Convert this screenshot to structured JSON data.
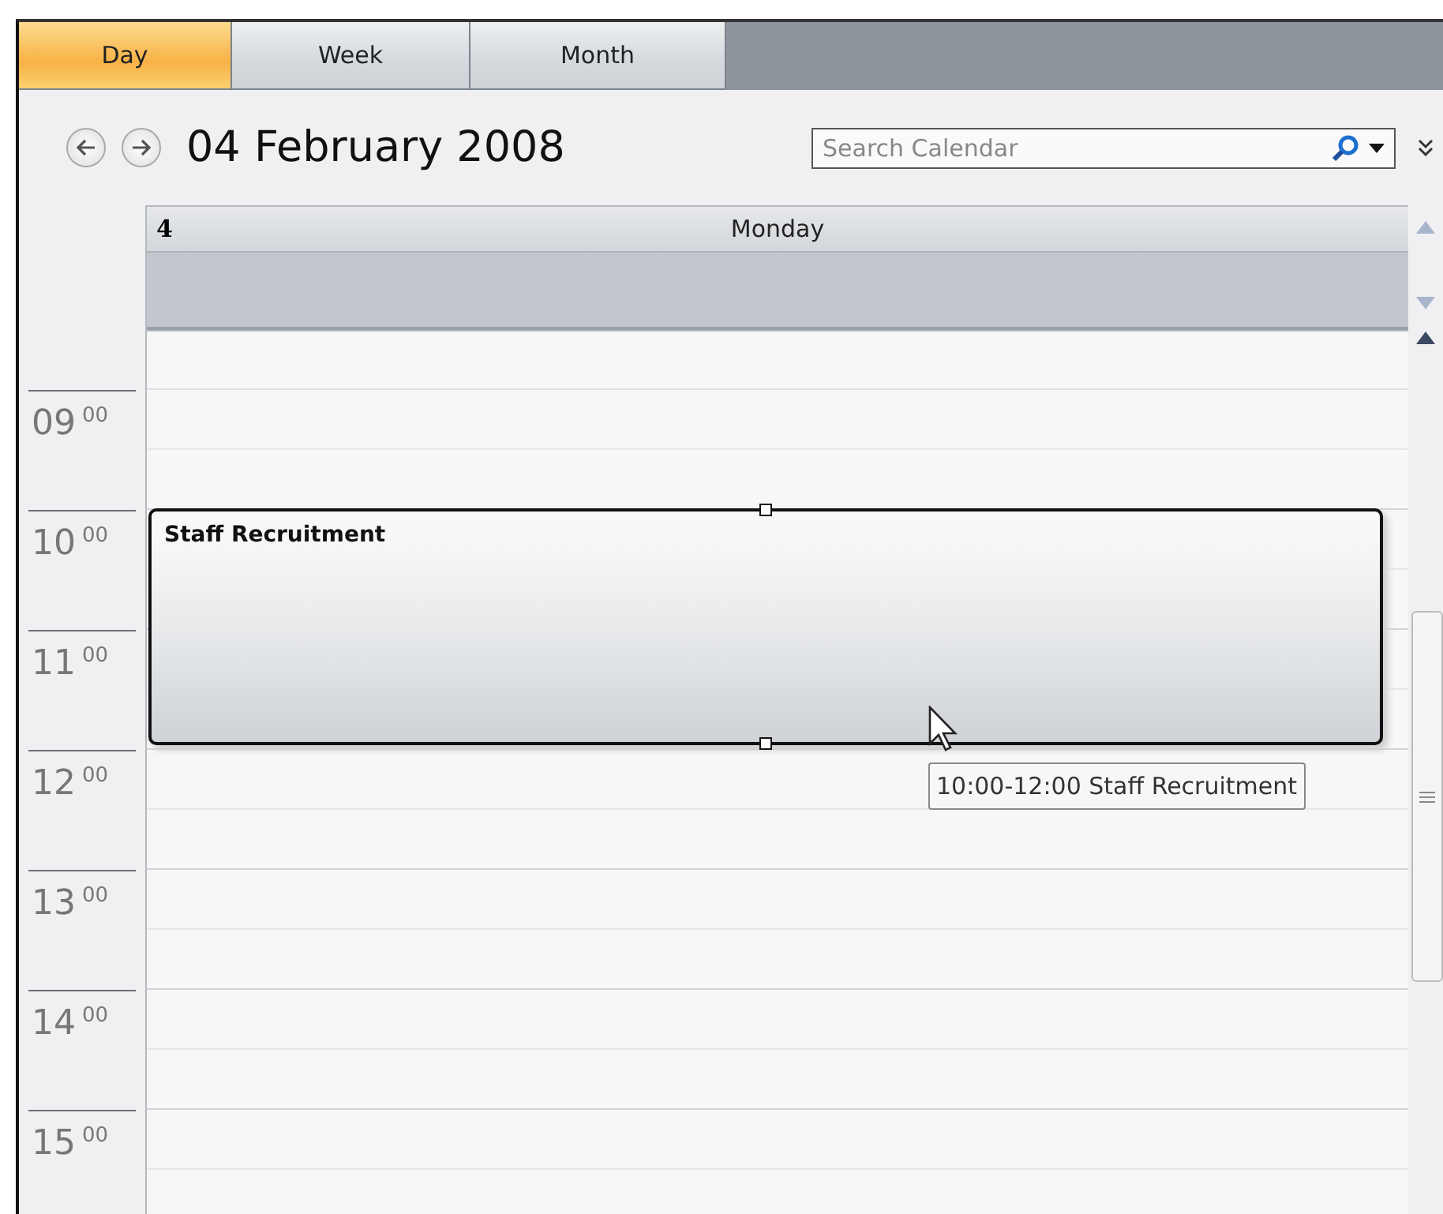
{
  "tabs": [
    {
      "label": "Day",
      "selected": true
    },
    {
      "label": "Week",
      "selected": false
    },
    {
      "label": "Month",
      "selected": false
    }
  ],
  "date_title": "04 February 2008",
  "search": {
    "placeholder": "Search Calendar"
  },
  "day_header": {
    "day_number": "4",
    "weekday": "Monday"
  },
  "hours": [
    {
      "hour": "09",
      "minutes": "00"
    },
    {
      "hour": "10",
      "minutes": "00"
    },
    {
      "hour": "11",
      "minutes": "00"
    },
    {
      "hour": "12",
      "minutes": "00"
    },
    {
      "hour": "13",
      "minutes": "00"
    },
    {
      "hour": "14",
      "minutes": "00"
    },
    {
      "hour": "15",
      "minutes": "00"
    }
  ],
  "event": {
    "title": "Staff Recruitment",
    "selected": true
  },
  "tooltip": "10:00-12:00 Staff Recruitment"
}
